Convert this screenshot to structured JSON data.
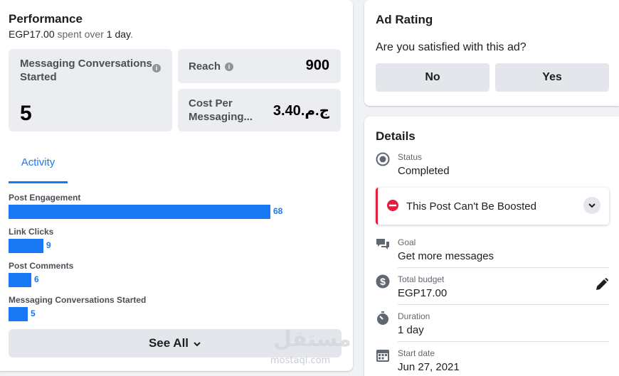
{
  "performance": {
    "title": "Performance",
    "spent_prefix": "EGP17.00",
    "spent_mid": " spent over ",
    "spent_days": "1 day",
    "spent_suffix": ".",
    "stats": {
      "messaging_label": "Messaging Conversations Started",
      "messaging_value": "5",
      "reach_label": "Reach",
      "reach_value": "900",
      "cost_label": "Cost Per Messaging...",
      "cost_value": "ج.م.3.40"
    },
    "tab_label": "Activity",
    "activity": [
      {
        "label": "Post Engagement",
        "value": 68
      },
      {
        "label": "Link Clicks",
        "value": 9
      },
      {
        "label": "Post Comments",
        "value": 6
      },
      {
        "label": "Messaging Conversations Started",
        "value": 5
      }
    ],
    "see_all_label": "See All"
  },
  "ad_rating": {
    "title": "Ad Rating",
    "question": "Are you satisfied with this ad?",
    "no_label": "No",
    "yes_label": "Yes"
  },
  "details": {
    "title": "Details",
    "status_label": "Status",
    "status_value": "Completed",
    "boost_text": "This Post Can't Be Boosted",
    "goal_label": "Goal",
    "goal_value": "Get more messages",
    "budget_label": "Total budget",
    "budget_value": "EGP17.00",
    "duration_label": "Duration",
    "duration_value": "1 day",
    "start_label": "Start date",
    "start_value": "Jun 27, 2021"
  },
  "watermark": {
    "arabic": "مستقل",
    "latin": "mostaql.com"
  },
  "colors": {
    "accent": "#1877f2",
    "error": "#e41e3f",
    "surface": "#ebedf0",
    "button": "#e4e6eb"
  }
}
